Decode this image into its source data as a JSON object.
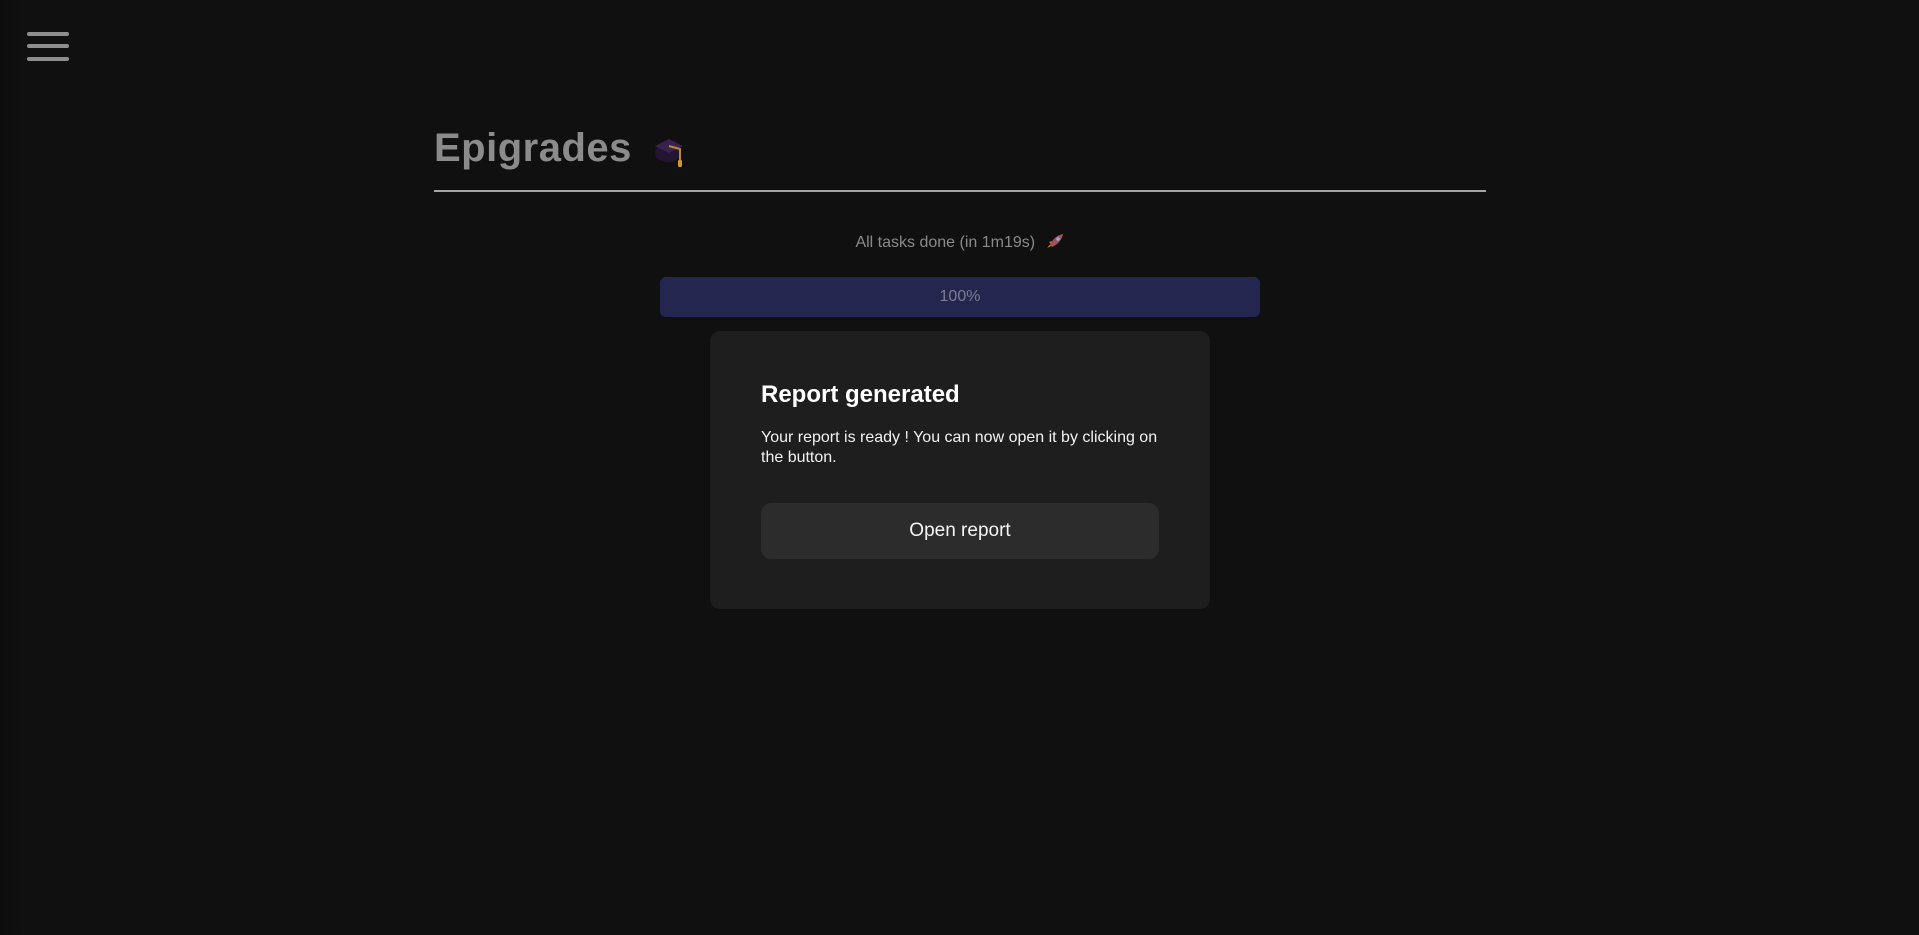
{
  "app": {
    "title": "Epigrades",
    "title_icon": "graduation-cap-icon",
    "menu_icon": "hamburger-menu-icon"
  },
  "status": {
    "text": "All tasks done (in 1m19s)",
    "icon": "rocket-icon"
  },
  "progress": {
    "value": 1.0,
    "label": "100%",
    "fill_color": "#25264f",
    "track_color": "#1d1d2d"
  },
  "report_card": {
    "title": "Report generated",
    "message": "Your report is ready ! You can now open it by clicking on the button.",
    "button_label": "Open report"
  },
  "colors": {
    "background": "#101011",
    "card": "#1e1e1f",
    "button": "#2c2c2d",
    "title_text": "#8b8b8b"
  }
}
